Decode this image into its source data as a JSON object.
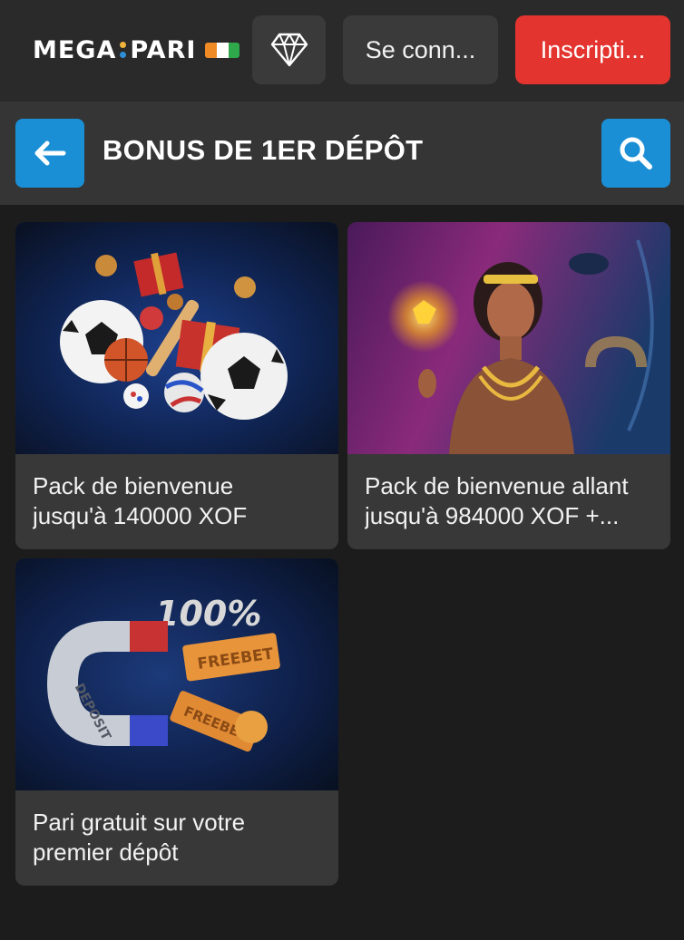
{
  "brand": {
    "left": "MEGA",
    "right": "PARI"
  },
  "colors": {
    "accent_blue": "#1a8fd6",
    "register_red": "#e3342f",
    "flag": [
      "#f08a24",
      "#ffffff",
      "#2ea84a"
    ]
  },
  "topbar": {
    "diamond_icon": "diamond-icon",
    "login_label": "Se conn...",
    "register_label": "Inscripti..."
  },
  "header": {
    "back_icon": "arrow-left-icon",
    "title": "BONUS DE 1ER DÉPÔT",
    "search_icon": "search-icon"
  },
  "cards": [
    {
      "line1": "Pack de bienvenue",
      "line2": "jusqu'à 140000 XOF"
    },
    {
      "line1": "Pack de bienvenue allant",
      "line2": "jusqu'à 984000 XOF +..."
    },
    {
      "line1": "Pari gratuit sur votre",
      "line2": "premier dépôt",
      "art_text": {
        "percent": "100%",
        "ticket": "FREEBET",
        "magnet": "DEPOSIT"
      }
    }
  ]
}
